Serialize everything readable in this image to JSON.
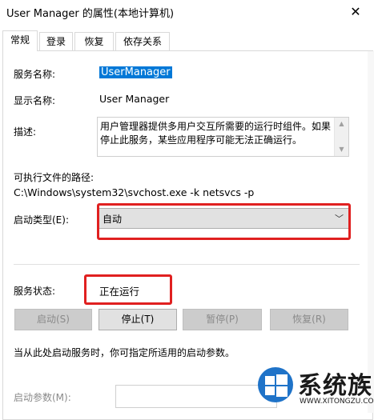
{
  "window": {
    "title": "User Manager 的属性(本地计算机)",
    "close_glyph": "✕"
  },
  "tabs": [
    "常规",
    "登录",
    "恢复",
    "依存关系"
  ],
  "general": {
    "service_name_label": "服务名称:",
    "service_name": "UserManager",
    "display_name_label": "显示名称:",
    "display_name": "User Manager",
    "description_label": "描述:",
    "description": "用户管理器提供多用户交互所需要的运行时组件。如果停止此服务，某些应用程序可能无法正确运行。",
    "exe_path_label": "可执行文件的路径:",
    "exe_path": "C:\\Windows\\system32\\svchost.exe -k netsvcs -p",
    "startup_type_label": "启动类型(E):",
    "startup_type": "自动",
    "service_status_label": "服务状态:",
    "service_status": "正在运行",
    "buttons": {
      "start": "启动(S)",
      "stop": "停止(T)",
      "pause": "暂停(P)",
      "resume": "恢复(R)"
    },
    "hint": "当从此处启动服务时，你可指定所适用的启动参数。",
    "start_params_label": "启动参数(M):",
    "start_params_value": ""
  },
  "watermark": {
    "text": "系统族",
    "url": "WWW.XITONGZU.COM"
  },
  "colors": {
    "highlight": "#0078d7",
    "annotation_red": "#e02020",
    "logo_blue": "#1f73c8"
  }
}
